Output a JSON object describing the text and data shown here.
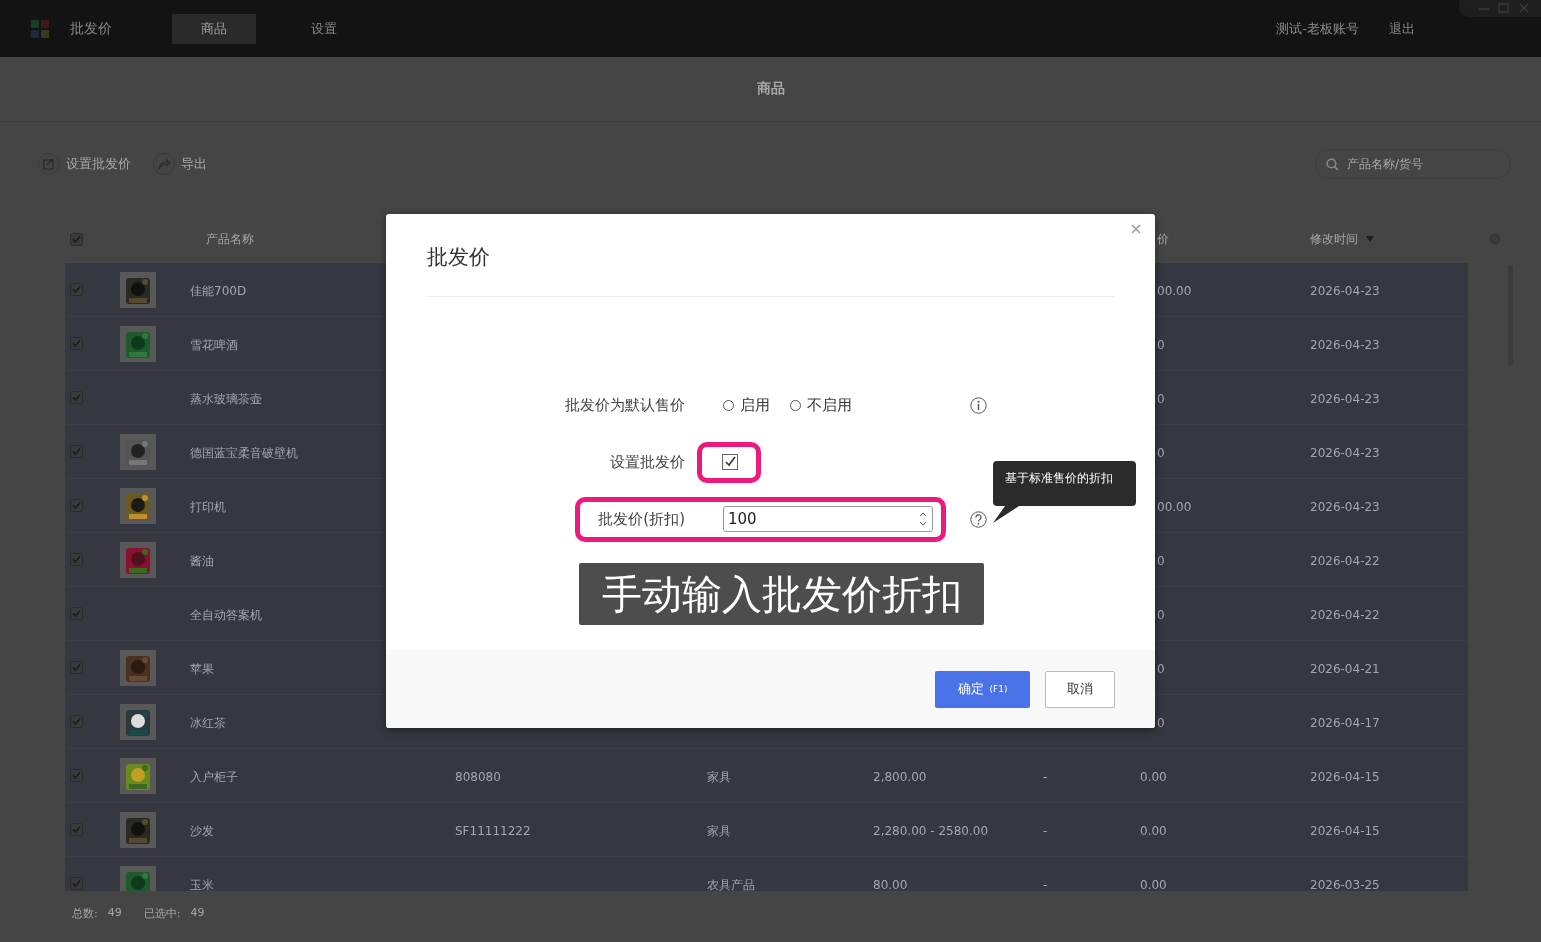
{
  "app": {
    "name": "批发价"
  },
  "nav_tabs": [
    {
      "label": "商品",
      "selected": true
    },
    {
      "label": "设置",
      "selected": false
    }
  ],
  "account": "测试-老板账号",
  "logout": "退出",
  "page_title": "商品",
  "toolbar": [
    {
      "label": "设置批发价",
      "kind": "edit"
    },
    {
      "label": "导出",
      "kind": "share"
    }
  ],
  "search": {
    "placeholder": "产品名称/货号"
  },
  "table": {
    "header": {
      "checked": true,
      "name": "产品名称",
      "column_7": "价",
      "modified": "修改时间",
      "sort_desc": true
    },
    "rows": [
      {
        "selected": true,
        "name": "佳能700D",
        "column_7": "00.00",
        "column_7_cut": true,
        "modified": "2026-04-23"
      },
      {
        "selected": true,
        "name": "雪花啤酒",
        "column_7": "0",
        "column_7_cut": true,
        "modified": "2026-04-23"
      },
      {
        "selected": true,
        "name": "蒸水玻璃茶壶",
        "column_7": "0",
        "column_7_cut": true,
        "modified": "2026-04-23"
      },
      {
        "selected": true,
        "name": "德国蓝宝柔音破壁机",
        "column_7": "0",
        "column_7_cut": true,
        "modified": "2026-04-23"
      },
      {
        "selected": true,
        "name": "打印机",
        "column_7": "00.00",
        "column_7_cut": true,
        "modified": "2026-04-23"
      },
      {
        "selected": true,
        "name": "酱油",
        "column_7": "0",
        "column_7_cut": true,
        "modified": "2026-04-22"
      },
      {
        "selected": true,
        "name": "全自动答案机",
        "column_7": "0",
        "column_7_cut": true,
        "modified": "2026-04-22"
      },
      {
        "selected": true,
        "name": "苹果",
        "column_7": "0",
        "column_7_cut": true,
        "modified": "2026-04-21"
      },
      {
        "selected": true,
        "name": "冰红茶",
        "column_7": "0",
        "column_7_cut": true,
        "modified": "2026-04-17"
      },
      {
        "selected": true,
        "name": "入户柜子",
        "code": "808080",
        "category": "家具",
        "price": "2,800.00",
        "column_6": "-",
        "column_7": "0.00",
        "modified": "2026-04-15"
      },
      {
        "selected": true,
        "name": "沙发",
        "code": "SF11111222",
        "category": "家具",
        "price": "2,280.00 - 2580.00",
        "column_6": "-",
        "column_7": "0.00",
        "modified": "2026-04-15"
      },
      {
        "selected": true,
        "name": "玉米",
        "category": "农具产品",
        "price": "80.00",
        "column_6": "-",
        "column_7": "0.00",
        "modified": "2026-03-25"
      }
    ]
  },
  "footer": {
    "total_label": "总数:",
    "total": "49",
    "selected_label": "已选中:",
    "selected": "49"
  },
  "dialog": {
    "title": "批发价",
    "default_price": {
      "label": "批发价为默认售价",
      "options": [
        {
          "label": "启用",
          "selected": false
        },
        {
          "label": "不启用",
          "selected": false
        }
      ]
    },
    "set_wholesale": {
      "label": "设置批发价",
      "checked": true,
      "highlighted": true
    },
    "discount": {
      "label": "批发价(折扣)",
      "value": "100",
      "highlighted": true
    },
    "tooltip": "基于标准售价的折扣",
    "caption": "手动输入批发价折扣",
    "buttons": [
      {
        "label": "确定",
        "hint": "(F1)",
        "kind": "primary"
      },
      {
        "label": "取消",
        "kind": "secondary"
      }
    ]
  }
}
